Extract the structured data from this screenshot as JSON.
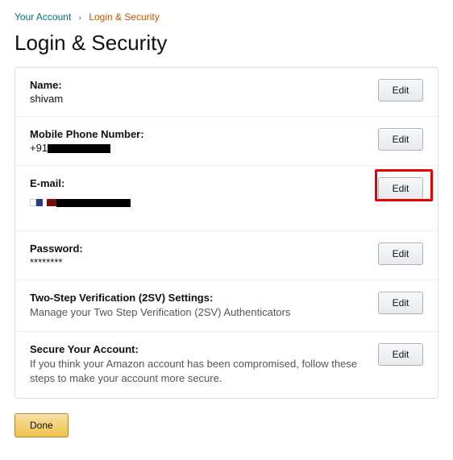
{
  "breadcrumb": {
    "parent": "Your Account",
    "current": "Login & Security"
  },
  "page_title": "Login & Security",
  "rows": {
    "name": {
      "label": "Name:",
      "value": "shivam",
      "edit": "Edit"
    },
    "phone": {
      "label": "Mobile Phone Number:",
      "prefix": "+91",
      "edit": "Edit"
    },
    "email": {
      "label": "E-mail:",
      "edit": "Edit"
    },
    "password": {
      "label": "Password:",
      "value": "********",
      "edit": "Edit"
    },
    "twostep": {
      "label": "Two-Step Verification (2SV) Settings:",
      "desc": "Manage your Two Step Verification (2SV) Authenticators",
      "edit": "Edit"
    },
    "secure": {
      "label": "Secure Your Account:",
      "desc": "If you think your Amazon account has been compromised, follow these steps to make your account more secure.",
      "edit": "Edit"
    }
  },
  "done_label": "Done"
}
